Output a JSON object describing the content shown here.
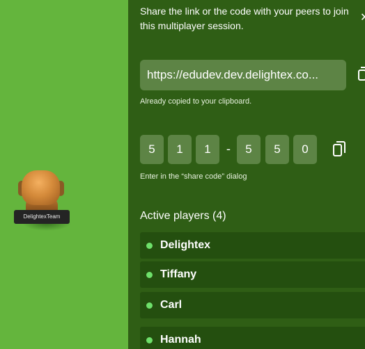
{
  "scene": {
    "avatar_name": "DelightexTeam"
  },
  "share": {
    "intro": "Share the link or the code with your peers to join this multiplayer session.",
    "link": "https://edudev.dev.delightex.co...",
    "copied_note": "Already copied to your clipboard.",
    "code_digits": [
      "5",
      "1",
      "1",
      "5",
      "5",
      "0"
    ],
    "code_separator": "-",
    "code_note": "Enter in the “share code” dialog",
    "close_icon": "close-icon",
    "copy_icon": "copy-icon"
  },
  "players": {
    "title": "Active players (4)",
    "items": [
      {
        "name": "Delightex"
      },
      {
        "name": "Tiffany"
      },
      {
        "name": "Carl"
      },
      {
        "name": "Hannah"
      }
    ],
    "online_color": "#6ee06a"
  },
  "colors": {
    "scene_green": "#63b43c",
    "panel_bg": "#2f5e15",
    "field_bg": "#5d8445",
    "row_bg": "#244f0f"
  }
}
